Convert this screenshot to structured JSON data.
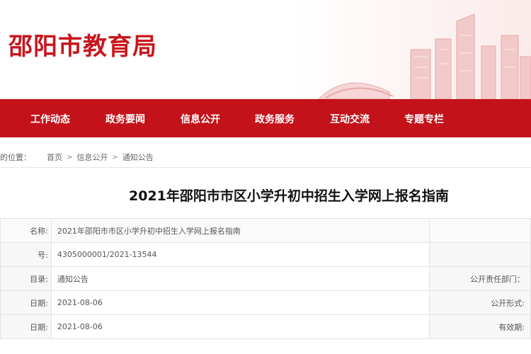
{
  "header": {
    "site_title": "邵阳市教育局"
  },
  "nav": {
    "items": [
      {
        "label": "工作动态"
      },
      {
        "label": "政务要闻"
      },
      {
        "label": "信息公开"
      },
      {
        "label": "政务服务"
      },
      {
        "label": "互动交流"
      },
      {
        "label": "专题专栏"
      }
    ]
  },
  "breadcrumb": {
    "prefix": "的位置：",
    "items": [
      "首页",
      "信息公开",
      "通知公告"
    ]
  },
  "article": {
    "title": "2021年邵阳市市区小学升初中招生入学网上报名指南"
  },
  "info": {
    "rows": [
      {
        "label": "名称:",
        "value": "2021年邵阳市市区小学升初中招生入学网上报名指南",
        "label2": "",
        "value2": ""
      },
      {
        "label": "号:",
        "value": "4305000001/2021-13544",
        "label2": "",
        "value2": ""
      },
      {
        "label": "目录:",
        "value": "通知公告",
        "label2": "公开责任部门：",
        "value2": ""
      },
      {
        "label": "日期:",
        "value": "2021-08-06",
        "label2": "公开形式:",
        "value2": ""
      },
      {
        "label": "日期:",
        "value": "2021-08-06",
        "label2": "有效期:",
        "value2": ""
      }
    ]
  },
  "colors": {
    "brand_red": "#c4121a",
    "title_red": "#c8161d"
  }
}
